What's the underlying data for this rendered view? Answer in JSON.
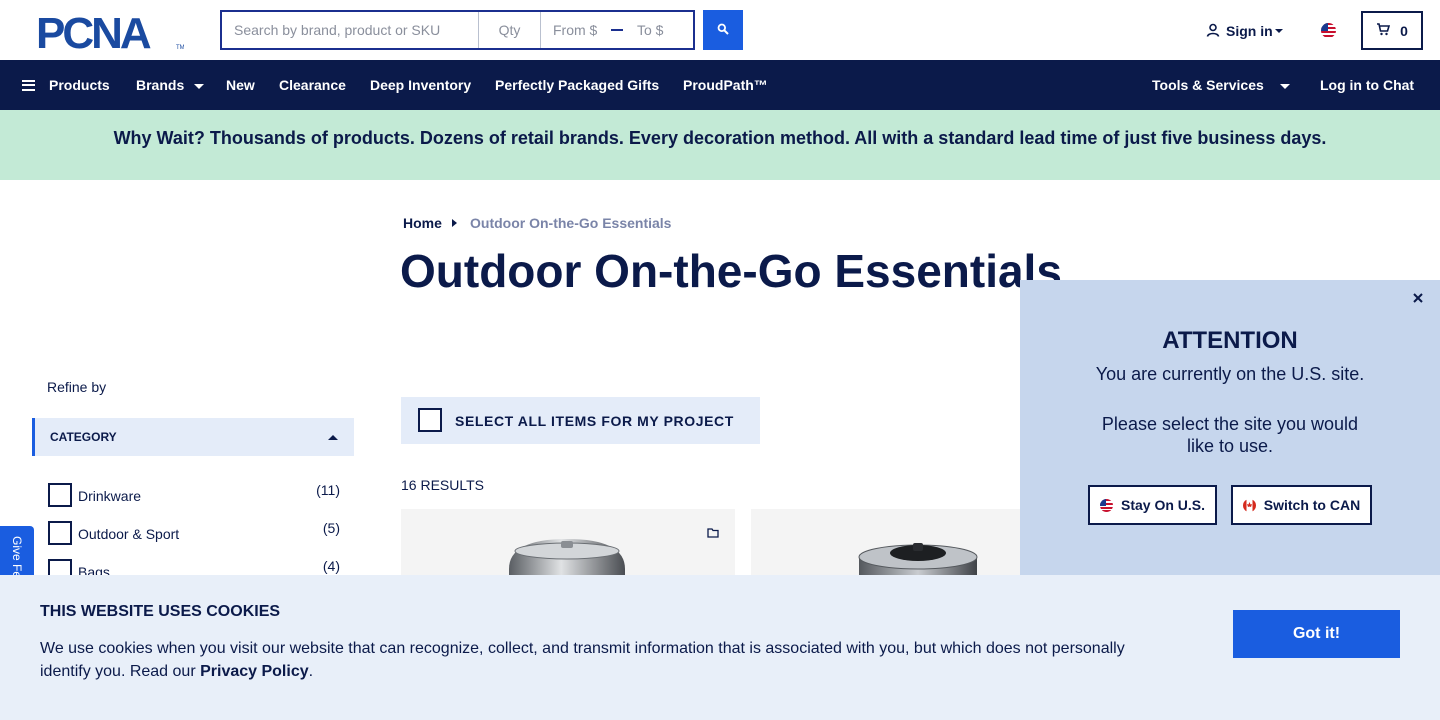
{
  "header": {
    "logo_text": "PCNA",
    "search": {
      "placeholder": "Search by brand, product or SKU",
      "qty_placeholder": "Qty",
      "from_placeholder": "From $",
      "to_placeholder": "To $"
    },
    "signin_label": "Sign in",
    "cart_count": "0",
    "icons": [
      "search-icon",
      "user-icon",
      "us-flag-icon",
      "cart-icon"
    ]
  },
  "nav": {
    "products": "Products",
    "brands": "Brands",
    "new": "New",
    "clearance": "Clearance",
    "deep_inventory": "Deep Inventory",
    "perfectly_packaged": "Perfectly Packaged Gifts",
    "proudpath": "ProudPath™",
    "tools_services": "Tools & Services",
    "chat": "Log in to Chat"
  },
  "banner": {
    "text": "Why Wait? Thousands of products. Dozens of retail brands. Every decoration method. All with a standard lead time of just five business days."
  },
  "breadcrumb": {
    "home": "Home",
    "current": "Outdoor On-the-Go Essentials"
  },
  "page_title": "Outdoor On-the-Go Essentials",
  "sidebar": {
    "refine_label": "Refine by",
    "category_header": "CATEGORY",
    "categories": [
      {
        "label": "Drinkware",
        "count": "(11)"
      },
      {
        "label": "Outdoor & Sport",
        "count": "(5)"
      },
      {
        "label": "Bags",
        "count": "(4)"
      }
    ],
    "feedback_label": "Give Feedback"
  },
  "results": {
    "select_all_label": "SELECT ALL ITEMS FOR MY PROJECT",
    "count_label": "16 RESULTS"
  },
  "popup": {
    "title": "ATTENTION",
    "line1": "You are currently on the U.S. site.",
    "line2": "Please select the site you would like to use.",
    "stay_label": "Stay On U.S.",
    "switch_label": "Switch to CAN"
  },
  "cookie": {
    "title": "THIS WEBSITE USES COOKIES",
    "text": "We use cookies when you visit our website that can recognize, collect, and transmit information that is associated with you, but which does not personally identify you. Read our ",
    "link": "Privacy Policy",
    "suffix": ".",
    "button": "Got it!"
  },
  "colors": {
    "navy": "#0b1a4a",
    "accent_blue": "#1a5de0",
    "banner_green": "#c3ead6",
    "popup_bg": "#c6d6ed",
    "cookie_bg": "#e8eff9"
  }
}
